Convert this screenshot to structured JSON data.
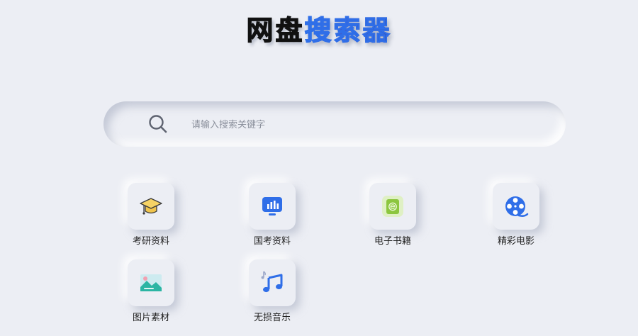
{
  "title": {
    "part1": "网盘",
    "part2": "搜索器"
  },
  "search": {
    "icon": "search-icon",
    "placeholder": "请输入搜索关键字",
    "value": ""
  },
  "categories": [
    {
      "label": "考研资料",
      "icon": "graduation-cap-icon"
    },
    {
      "label": "国考资料",
      "icon": "chart-screen-icon"
    },
    {
      "label": "电子书籍",
      "icon": "ebook-icon"
    },
    {
      "label": "精彩电影",
      "icon": "film-reel-icon"
    },
    {
      "label": "图片素材",
      "icon": "landscape-image-icon"
    },
    {
      "label": "无损音乐",
      "icon": "music-note-icon"
    }
  ],
  "colors": {
    "background": "#eceef4",
    "title_dark": "#111111",
    "title_blue": "#2f6ee8",
    "accent_blue": "#2f6ee8",
    "ebook_green": "#8cc63f",
    "image_teal": "#2bb5a3"
  }
}
